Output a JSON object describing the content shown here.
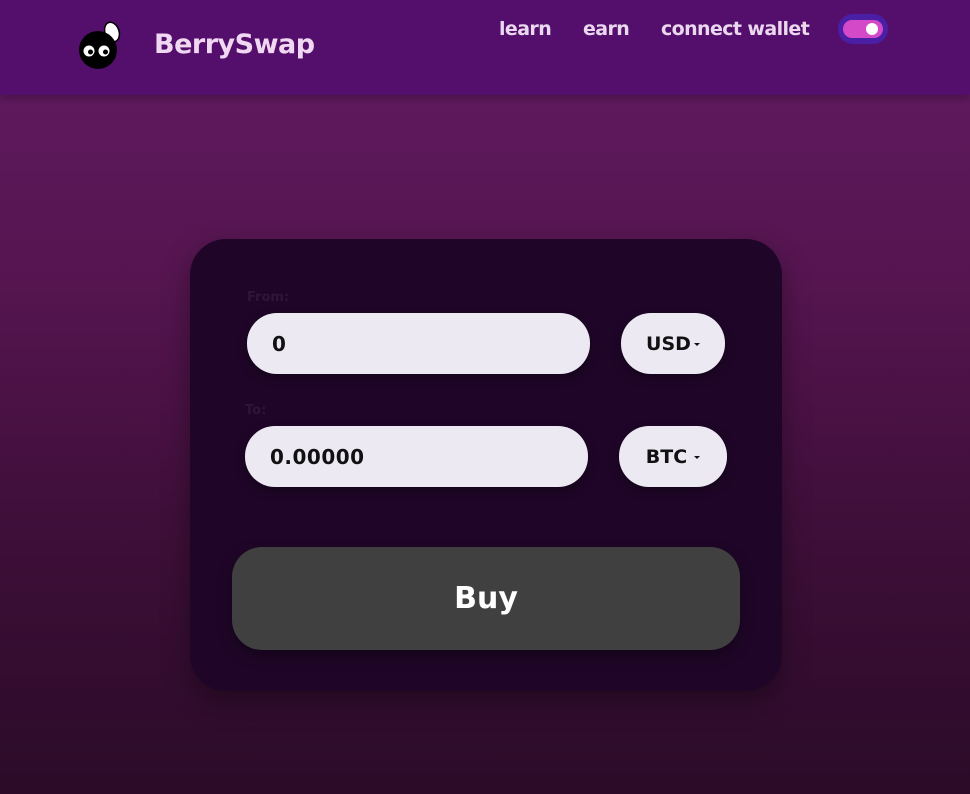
{
  "brand": {
    "name": "BerrySwap",
    "logo_icon": "berry-mascot-icon"
  },
  "nav": {
    "links": [
      "learn",
      "earn",
      "connect wallet"
    ],
    "theme_toggle_on": true
  },
  "form": {
    "from_label": "From:",
    "from_amount": "0",
    "from_currency": "USD",
    "to_label": "To:",
    "to_amount": "0.00000",
    "to_currency": "BTC",
    "dropdown_icon": "caret-down-icon"
  },
  "buy_label": "Buy",
  "colors": {
    "navbar": "#540e6c",
    "brand_text": "#f1d8f2",
    "card": "#1f0628",
    "input_bg": "#ece9f3",
    "buy_button": "#404040",
    "toggle_accent": "#d349c7"
  }
}
